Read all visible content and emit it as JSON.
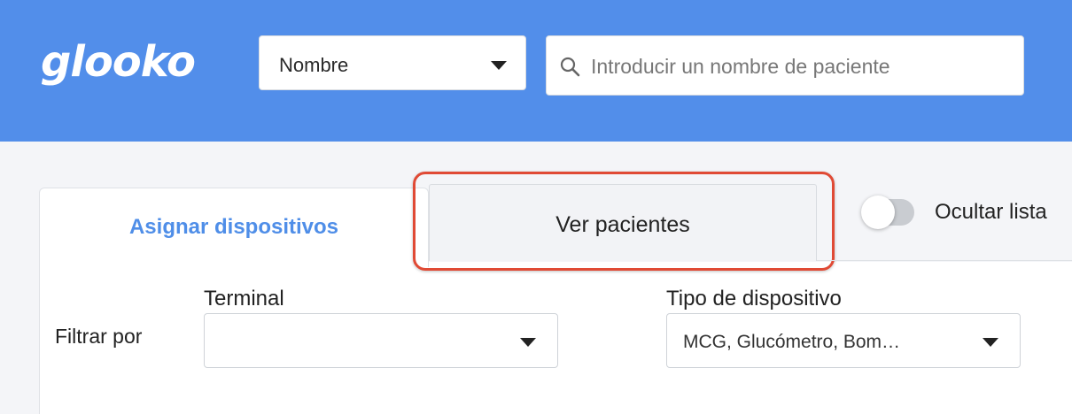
{
  "header": {
    "logo": "glooko",
    "search_by": "Nombre",
    "search_placeholder": "Introducir un nombre de paciente",
    "background_color": "#528eea"
  },
  "tabs": [
    {
      "label": "Asignar dispositivos",
      "active": true
    },
    {
      "label": "Ver pacientes",
      "active": false,
      "highlighted": true
    }
  ],
  "toggle": {
    "label": "Ocultar lista",
    "on": false
  },
  "filters": {
    "filter_by_label": "Filtrar por",
    "terminal": {
      "label": "Terminal",
      "value": ""
    },
    "device_type": {
      "label": "Tipo de dispositivo",
      "value": "MCG, Glucómetro, Bom…"
    }
  },
  "colors": {
    "accent": "#4f8ee8",
    "highlight": "#e04a35"
  }
}
